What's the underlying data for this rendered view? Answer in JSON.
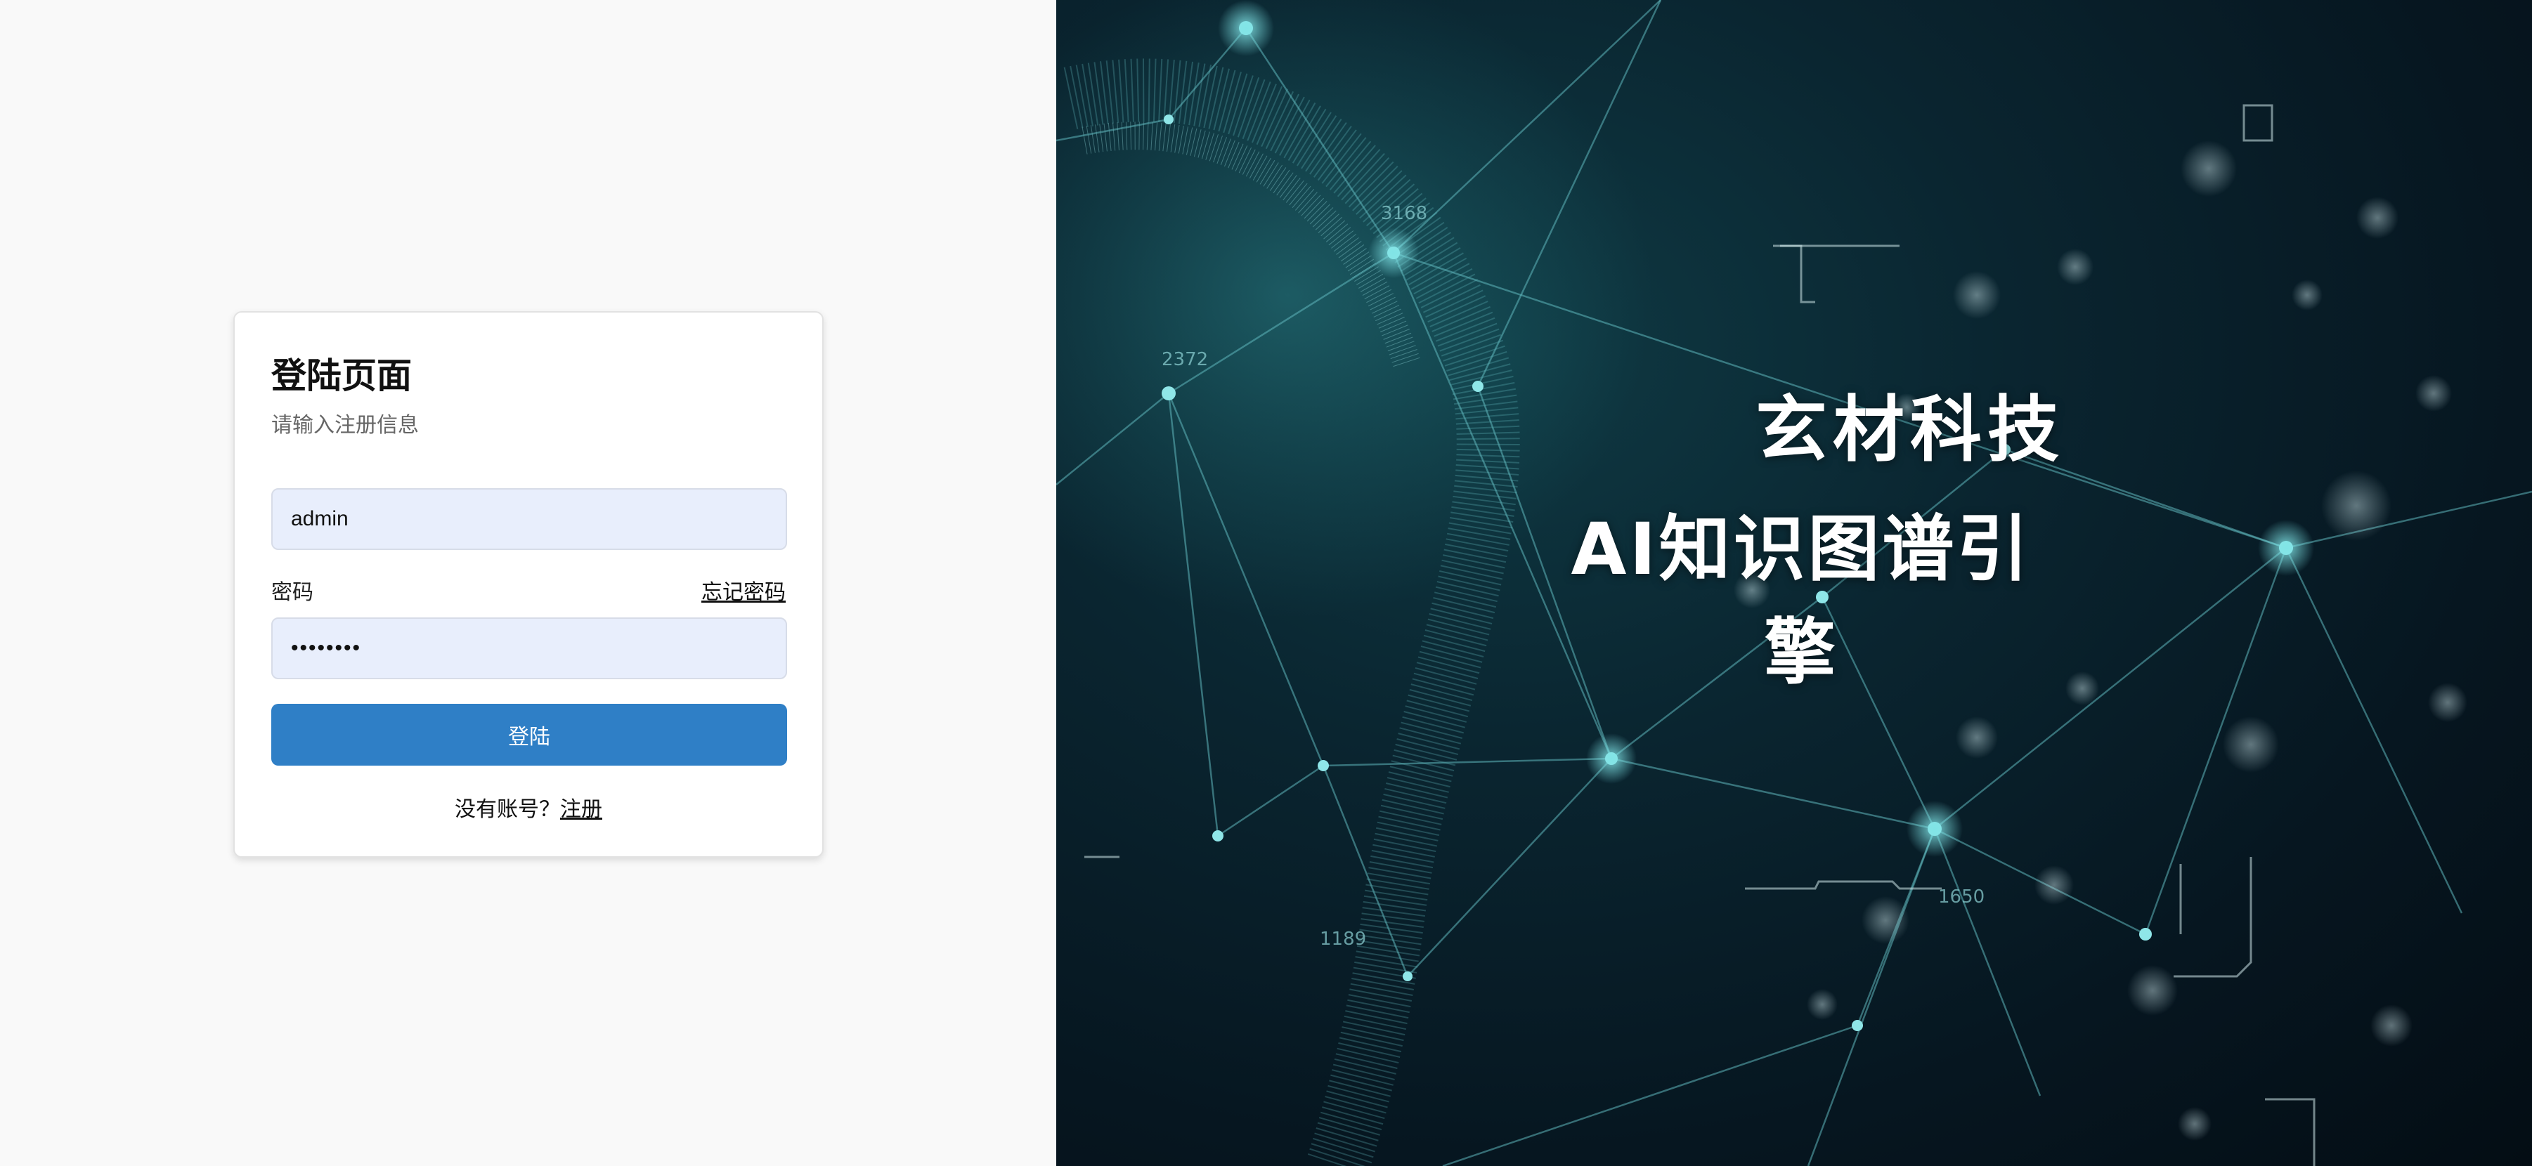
{
  "login_card": {
    "title": "登陆页面",
    "subtitle": "请输入注册信息",
    "username_value": "admin",
    "password_label": "密码",
    "forgot_password": "忘记密码",
    "password_value": "••••••••",
    "login_button": "登陆",
    "no_account_text": "没有账号？",
    "register_link": "注册"
  },
  "hero": {
    "line1": "玄材科技",
    "line2": "AI知识图谱引擎",
    "numbers": [
      "3168",
      "2372",
      "1650",
      "1189"
    ]
  },
  "colors": {
    "primary_button": "#2f7fc6",
    "input_background": "#e8eefc",
    "left_background": "#f9f9f9",
    "hero_background": "#061620",
    "network_accent": "#4fc3c8"
  },
  "icons": {
    "background": "network-globe-illustration"
  }
}
